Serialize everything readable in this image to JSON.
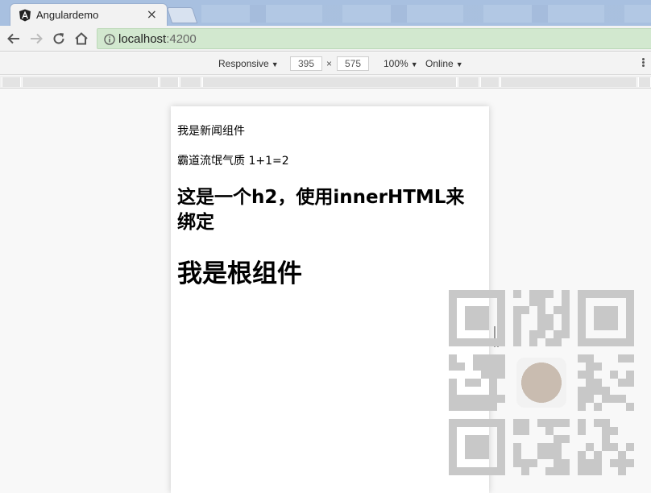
{
  "browser": {
    "tab": {
      "title": "Angulardemo",
      "close_glyph": "×",
      "favicon": "angular-logo-icon"
    },
    "url": {
      "host": "localhost",
      "port": ":4200"
    }
  },
  "device_toolbar": {
    "device": "Responsive",
    "width": "395",
    "times": "×",
    "height": "575",
    "zoom": "100%",
    "network": "Online",
    "caret": "▼"
  },
  "page": {
    "p1": "我是新闻组件",
    "p2": "霸道流氓气质 1+1=2",
    "h2": "这是一个h2，使用innerHTML来绑定",
    "h1": "我是根组件"
  },
  "colors": {
    "tabstrip": "#a8c0e0",
    "omnibox_secure": "#d2e8cf",
    "qr_module": "#c8c8c8"
  }
}
